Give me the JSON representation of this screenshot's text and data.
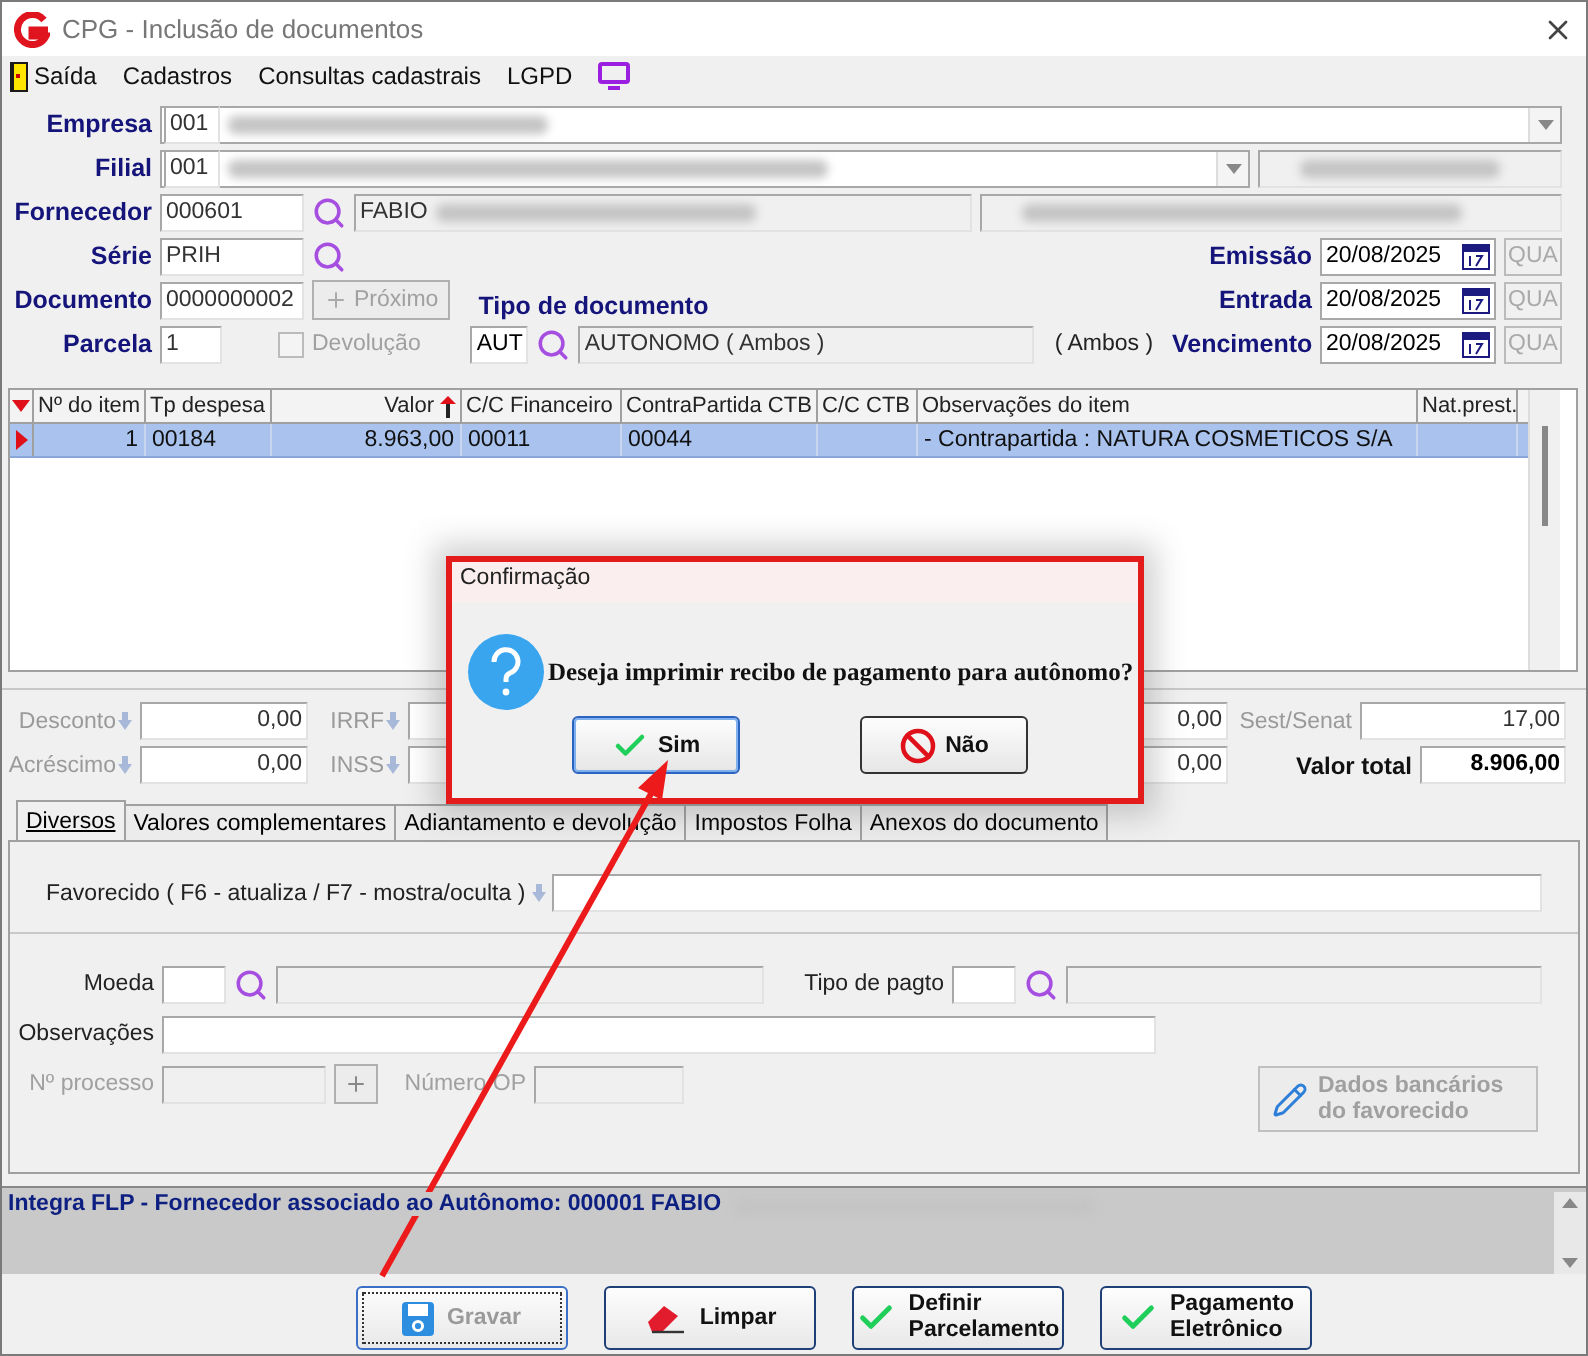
{
  "window": {
    "title": "CPG - Inclusão de documentos"
  },
  "menu": {
    "items": [
      "Saída",
      "Cadastros",
      "Consultas cadastrais",
      "LGPD"
    ]
  },
  "header": {
    "empresa": {
      "label": "Empresa",
      "code": "001"
    },
    "filial": {
      "label": "Filial",
      "code": "001"
    },
    "fornecedor": {
      "label": "Fornecedor",
      "code": "000601",
      "name": "FABIO"
    },
    "serie": {
      "label": "Série",
      "code": "PRIH"
    },
    "documento": {
      "label": "Documento",
      "code": "0000000002"
    },
    "proximo": {
      "label": "Próximo",
      "disabled": true
    },
    "parcela": {
      "label": "Parcela",
      "value": "1"
    },
    "devolucao": {
      "label": "Devolução",
      "checked": false,
      "disabled": true
    },
    "tipo_documento": {
      "label": "Tipo de documento",
      "code": "AUT",
      "name": "AUTONOMO ( Ambos )",
      "note": "( Ambos )"
    },
    "dates": [
      {
        "label": "Emissão",
        "value": "20/08/2025",
        "weekday": "QUA"
      },
      {
        "label": "Entrada",
        "value": "20/08/2025",
        "weekday": "QUA"
      },
      {
        "label": "Vencimento",
        "value": "20/08/2025",
        "weekday": "QUA"
      }
    ]
  },
  "table": {
    "columns": [
      "Nº do item",
      "Tp despesa",
      "Valor",
      "C/C Financeiro",
      "ContraPartida CTB",
      "C/C CTB",
      "Observações do item",
      "Nat.prest."
    ],
    "rows": [
      {
        "cells": [
          "1",
          "00184",
          "8.963,00",
          "00011",
          "00044",
          null,
          "- Contrapartida : NATURA COSMETICOS S/A",
          null
        ],
        "selected": true
      }
    ]
  },
  "totals": {
    "left": [
      {
        "label": "Desconto",
        "value": "0,00"
      },
      {
        "label": "Acréscimo",
        "value": "0,00"
      }
    ],
    "middle": [
      {
        "label": "IRRF"
      },
      {
        "label": "INSS"
      }
    ],
    "values": [
      "0,00",
      "0,00"
    ],
    "right": [
      {
        "label": "Sest/Senat",
        "value": "17,00",
        "kind": "normal"
      },
      {
        "label": "Valor total",
        "value": "8.906,00",
        "kind": "total"
      }
    ]
  },
  "tabs": [
    {
      "label": "Diversos",
      "selected": true
    },
    {
      "label": "Valores complementares",
      "selected": false
    },
    {
      "label": "Adiantamento e devolução",
      "selected": false
    },
    {
      "label": "Impostos Folha",
      "selected": false
    },
    {
      "label": "Anexos do documento",
      "selected": false
    }
  ],
  "panel": {
    "favorecido": {
      "label": "Favorecido ( F6 - atualiza / F7 - mostra/oculta )"
    },
    "moeda": {
      "label": "Moeda"
    },
    "tipo_pagto": {
      "label": "Tipo de pagto"
    },
    "observacoes": {
      "label": "Observações"
    },
    "processo": {
      "label": "Nº processo",
      "disabled": true
    },
    "numero_op": {
      "label": "Número OP",
      "disabled": true
    },
    "bank_button": {
      "lines": [
        "Dados bancários",
        "do favorecido"
      ],
      "disabled": true
    }
  },
  "status": {
    "text": "Integra FLP - Fornecedor associado ao Autônomo: 000001 FABIO"
  },
  "buttons": [
    {
      "lines": [
        "Gravar"
      ],
      "kind": "save",
      "disabled": true,
      "focused": true
    },
    {
      "lines": [
        "Limpar"
      ],
      "kind": "clear",
      "disabled": false,
      "focused": false
    },
    {
      "lines": [
        "Definir",
        "Parcelamento"
      ],
      "kind": "check",
      "disabled": false,
      "focused": false
    },
    {
      "lines": [
        "Pagamento",
        "Eletrônico"
      ],
      "kind": "check",
      "disabled": false,
      "focused": false
    }
  ],
  "dialog": {
    "title": "Confirmação",
    "message": "Deseja imprimir recibo de pagamento para autônomo?",
    "buttons": [
      {
        "label": "Sim",
        "kind": "yes",
        "focused": true
      },
      {
        "label": "Não",
        "kind": "no",
        "focused": false
      }
    ]
  }
}
